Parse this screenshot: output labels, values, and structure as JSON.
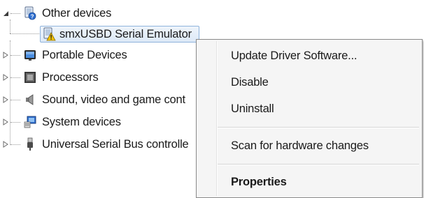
{
  "tree": {
    "items": [
      {
        "label": "Other devices",
        "icon": "unknown-device-icon",
        "state": "expanded"
      },
      {
        "label": "smxUSBD Serial Emulator",
        "icon": "warning-device-icon",
        "state": "leaf-selected"
      },
      {
        "label": "Portable Devices",
        "icon": "portable-device-icon",
        "state": "collapsed"
      },
      {
        "label": "Processors",
        "icon": "processor-icon",
        "state": "collapsed"
      },
      {
        "label": "Sound, video and game cont",
        "icon": "speaker-icon",
        "state": "collapsed"
      },
      {
        "label": "System devices",
        "icon": "system-device-icon",
        "state": "collapsed"
      },
      {
        "label": "Universal Serial Bus controlle",
        "icon": "usb-icon",
        "state": "collapsed"
      }
    ]
  },
  "context_menu": {
    "items": [
      {
        "label": "Update Driver Software..."
      },
      {
        "label": "Disable"
      },
      {
        "label": "Uninstall"
      },
      {
        "label": "Scan for hardware changes"
      },
      {
        "label": "Properties",
        "bold": true
      }
    ]
  },
  "colors": {
    "selection_fill": "#dde9f7",
    "selection_border": "#8fb3dc",
    "menu_background": "#f5f5f5",
    "menu_border": "#8a8a8a",
    "warning": "#f2c200"
  }
}
